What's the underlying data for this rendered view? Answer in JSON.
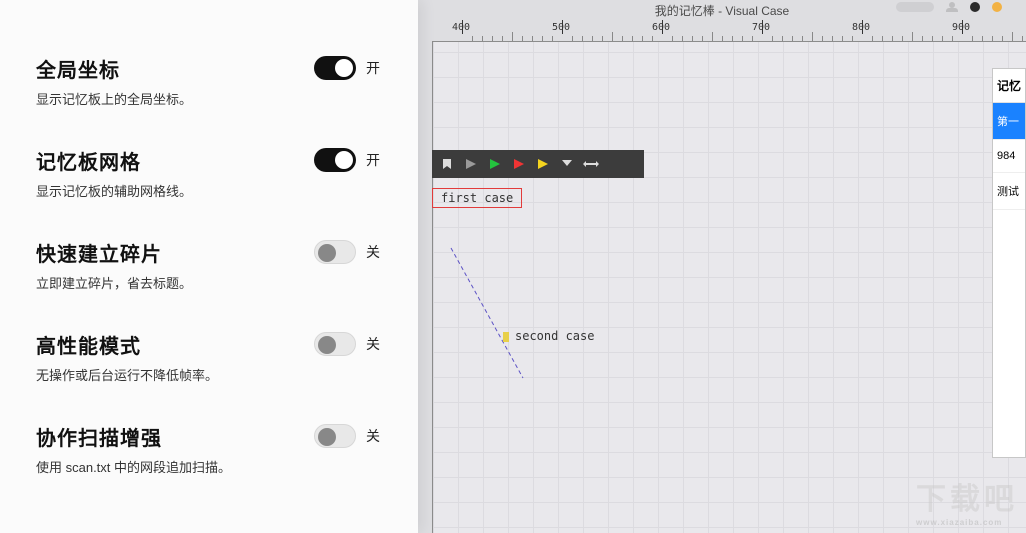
{
  "window_title": "我的记忆棒 - Visual Case",
  "settings": [
    {
      "title": "全局坐标",
      "desc": "显示记忆板上的全局坐标。",
      "state": "on",
      "label": "开"
    },
    {
      "title": "记忆板网格",
      "desc": "显示记忆板的辅助网格线。",
      "state": "on",
      "label": "开"
    },
    {
      "title": "快速建立碎片",
      "desc": "立即建立碎片，省去标题。",
      "state": "off",
      "label": "关"
    },
    {
      "title": "高性能模式",
      "desc": "无操作或后台运行不降低帧率。",
      "state": "off",
      "label": "关"
    },
    {
      "title": "协作扫描增强",
      "desc": "使用 scan.txt 中的网段追加扫描。",
      "state": "off",
      "label": "关"
    }
  ],
  "ruler_ticks": [
    400,
    500,
    600,
    700,
    800,
    900
  ],
  "cases": {
    "first": "first case",
    "second": "second case"
  },
  "right_panel": {
    "header": "记忆",
    "items": [
      {
        "label": "第一",
        "selected": true
      },
      {
        "label": "984",
        "selected": false
      },
      {
        "label": "测试",
        "selected": false
      }
    ]
  },
  "titlebar_dots": [
    "#cfcfd2",
    "#2b2b2b",
    "#f2b244"
  ],
  "watermark": {
    "big": "下载吧",
    "small": "www.xiazaiba.com"
  }
}
